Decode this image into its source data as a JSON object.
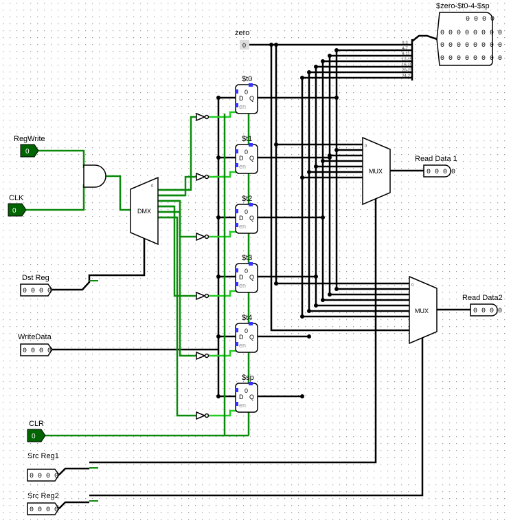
{
  "inputs": {
    "regwrite": {
      "label": "RegWrite",
      "value": "0"
    },
    "clk": {
      "label": "CLK",
      "value": "0"
    },
    "clr": {
      "label": "CLR",
      "value": "0"
    },
    "dst_reg": {
      "label": "Dst Reg",
      "value": "0 0 0 0"
    },
    "write_data": {
      "label": "WriteData",
      "value": "0 0 0 0"
    },
    "src_reg1": {
      "label": "Src Reg1",
      "value": "0 0 0 0"
    },
    "src_reg2": {
      "label": "Src Reg2",
      "value": "0 0 0 0"
    }
  },
  "constant": {
    "label": "zero",
    "value": "0"
  },
  "registers": [
    {
      "label": "$t0",
      "value": "0",
      "d": "D",
      "q": "Q",
      "en": "en"
    },
    {
      "label": "$t1",
      "value": "0",
      "d": "D",
      "q": "Q",
      "en": "en"
    },
    {
      "label": "$t2",
      "value": "0",
      "d": "D",
      "q": "Q",
      "en": "en"
    },
    {
      "label": "$t3",
      "value": "0",
      "d": "D",
      "q": "Q",
      "en": "en"
    },
    {
      "label": "$t4",
      "value": "0",
      "d": "D",
      "q": "Q",
      "en": "en"
    },
    {
      "label": "$sp",
      "value": "0",
      "d": "D",
      "q": "Q",
      "en": "en"
    }
  ],
  "demux": {
    "label": "DMX",
    "index": "0"
  },
  "mux1": {
    "label": "MUX",
    "index": "0"
  },
  "mux2": {
    "label": "MUX",
    "index": "0"
  },
  "outputs": {
    "read_data_1": {
      "label": "Read Data 1",
      "value": "0 0 0 0"
    },
    "read_data_2": {
      "label": "Read Data2",
      "value": "0 0 0 0"
    }
  },
  "splitter": {
    "bits": [
      "0-3",
      "4-7",
      "8-11",
      "12-15",
      "16-19",
      "20-23",
      "24-27"
    ]
  },
  "probe": {
    "label": "$zero-$t0-4-$sp",
    "rows": [
      "0 0 0 0",
      "0 0 0 0 0 0 0 0",
      "0 0 0 0 0 0 0 0",
      "0 0 0 0 0 0 0 0"
    ]
  },
  "colors": {
    "wire_low": "#0a8a0a",
    "wire_high": "#22cc22",
    "bus": "#000000",
    "pin": "#006400",
    "port": "#3333ff"
  }
}
